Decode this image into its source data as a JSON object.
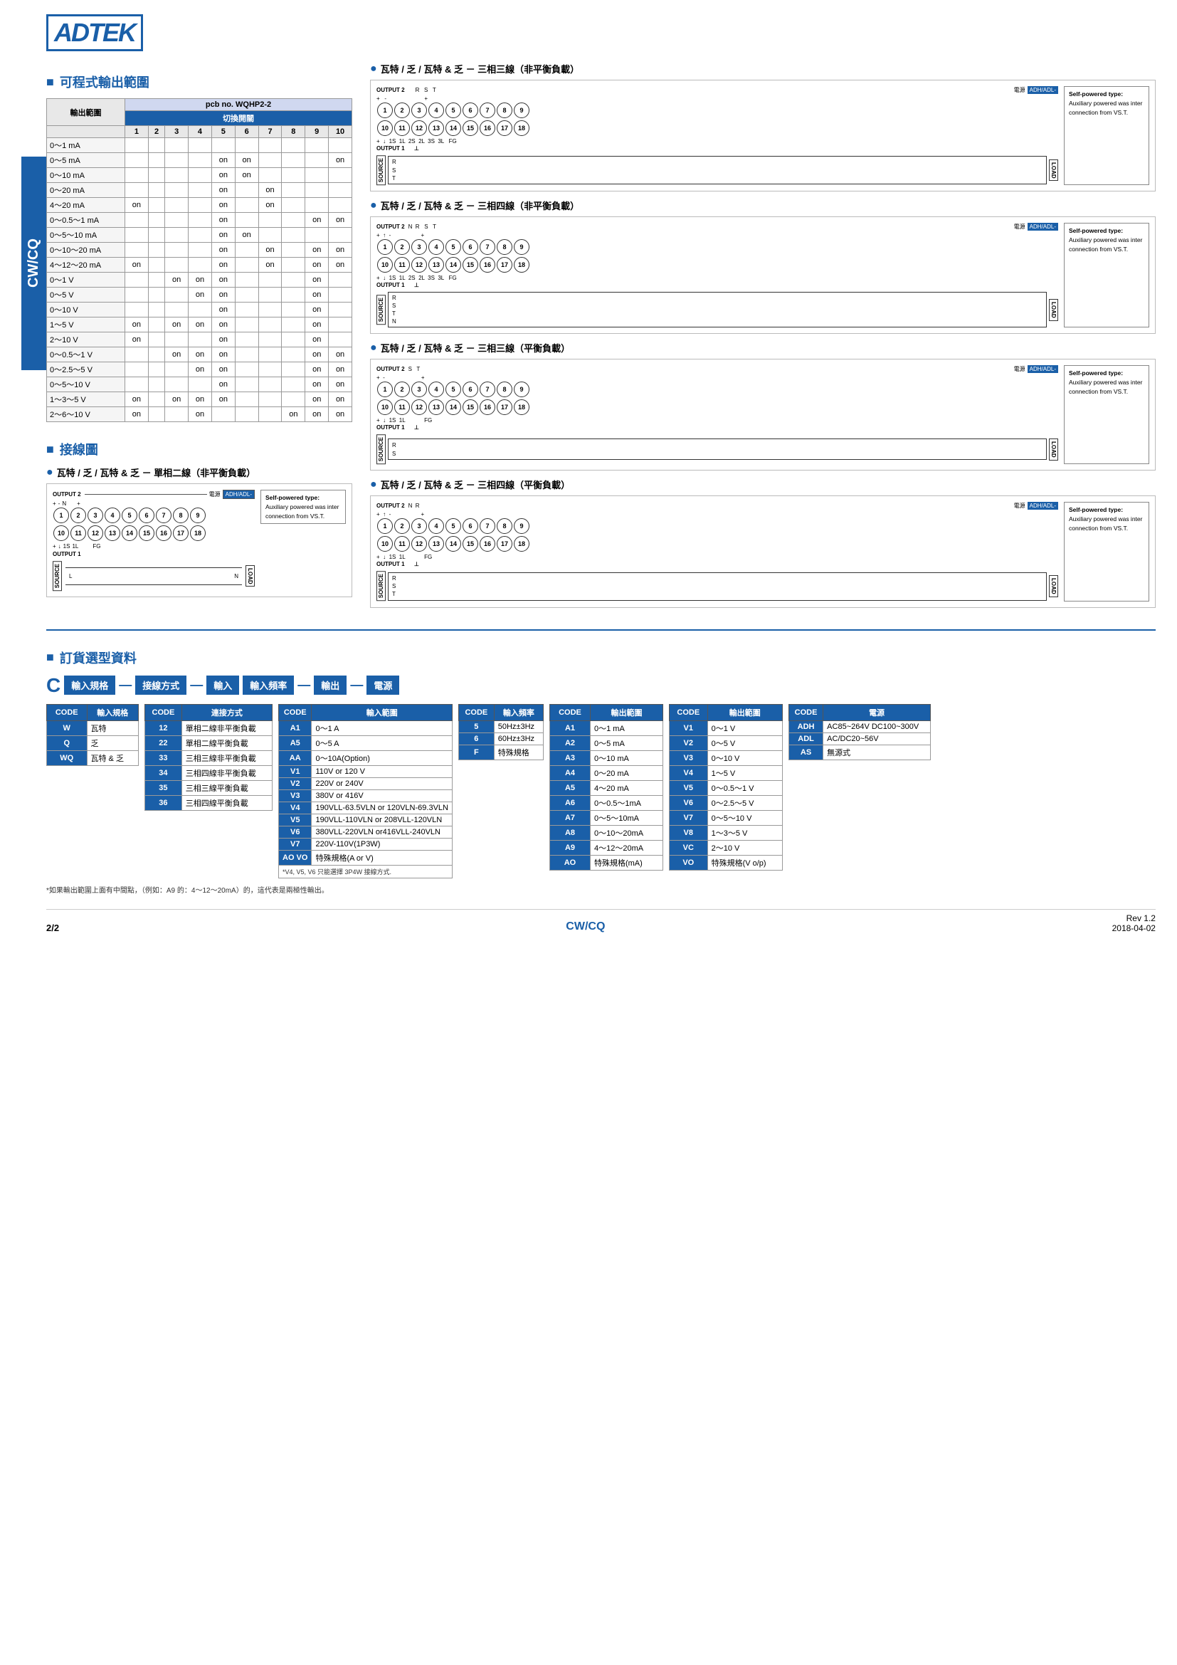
{
  "logo": "ADTEK",
  "page": {
    "number": "2/2",
    "model": "CW/CQ",
    "rev": "Rev 1.2",
    "date": "2018-04-02"
  },
  "sections": {
    "output_range": "可程式輸出範圍",
    "wiring": "接線圖",
    "order": "訂貨選型資料"
  },
  "output_range_table": {
    "pcb_header": "pcb no. WQHP2-2",
    "switch_header": "切換開關",
    "range_header": "輸出範圍",
    "columns": [
      "1",
      "2",
      "3",
      "4",
      "5",
      "6",
      "7",
      "8",
      "9",
      "10"
    ],
    "rows": [
      {
        "label": "0～1 mA",
        "cells": [
          "",
          "",
          "",
          "",
          "",
          "",
          "",
          "",
          "",
          ""
        ]
      },
      {
        "label": "0～5 mA",
        "cells": [
          "",
          "",
          "",
          "",
          "on",
          "on",
          "",
          "",
          "",
          "on"
        ]
      },
      {
        "label": "0～10 mA",
        "cells": [
          "",
          "",
          "",
          "",
          "on",
          "on",
          "",
          "",
          "",
          ""
        ]
      },
      {
        "label": "0～20 mA",
        "cells": [
          "",
          "",
          "",
          "",
          "on",
          "",
          "on",
          "",
          "",
          ""
        ]
      },
      {
        "label": "4～20 mA",
        "cells": [
          "on",
          "",
          "",
          "",
          "on",
          "",
          "on",
          "",
          "",
          ""
        ]
      },
      {
        "label": "0～0.5～1 mA",
        "cells": [
          "",
          "",
          "",
          "",
          "on",
          "",
          "",
          "",
          "on",
          "on"
        ]
      },
      {
        "label": "0～5～10 mA",
        "cells": [
          "",
          "",
          "",
          "",
          "on",
          "on",
          "",
          "",
          "",
          ""
        ]
      },
      {
        "label": "0～10～20 mA",
        "cells": [
          "",
          "",
          "",
          "",
          "on",
          "",
          "on",
          "",
          "on",
          "on"
        ]
      },
      {
        "label": "4～12～20 mA",
        "cells": [
          "on",
          "",
          "",
          "",
          "on",
          "",
          "on",
          "",
          "on",
          "on"
        ]
      },
      {
        "label": "0～1 V",
        "cells": [
          "",
          "",
          "on",
          "on",
          "on",
          "",
          "",
          "",
          "on",
          ""
        ]
      },
      {
        "label": "0～5 V",
        "cells": [
          "",
          "",
          "",
          "on",
          "on",
          "",
          "",
          "",
          "on",
          ""
        ]
      },
      {
        "label": "0～10 V",
        "cells": [
          "",
          "",
          "",
          "",
          "on",
          "",
          "",
          "",
          "on",
          ""
        ]
      },
      {
        "label": "1～5 V",
        "cells": [
          "on",
          "",
          "on",
          "on",
          "on",
          "",
          "",
          "",
          "on",
          ""
        ]
      },
      {
        "label": "2～10 V",
        "cells": [
          "on",
          "",
          "",
          "",
          "on",
          "",
          "",
          "",
          "on",
          ""
        ]
      },
      {
        "label": "0～0.5～1 V",
        "cells": [
          "",
          "",
          "on",
          "on",
          "on",
          "",
          "",
          "",
          "on",
          "on"
        ]
      },
      {
        "label": "0～2.5～5 V",
        "cells": [
          "",
          "",
          "",
          "on",
          "on",
          "",
          "",
          "",
          "on",
          "on"
        ]
      },
      {
        "label": "0～5～10 V",
        "cells": [
          "",
          "",
          "",
          "",
          "on",
          "",
          "",
          "",
          "on",
          "on"
        ]
      },
      {
        "label": "1～3～5 V",
        "cells": [
          "on",
          "",
          "on",
          "on",
          "on",
          "",
          "",
          "",
          "on",
          "on"
        ]
      },
      {
        "label": "2～6～10 V",
        "cells": [
          "on",
          "",
          "",
          "on",
          "",
          "",
          "",
          "on",
          "on",
          "on"
        ]
      }
    ]
  },
  "wiring_diagrams": {
    "single_phase_unbalanced": {
      "title": "瓦特 / 乏 / 瓦特 & 乏 － 單相二線（非平衡負載）",
      "terminals_top": [
        "1",
        "2",
        "3",
        "4",
        "5",
        "6",
        "7",
        "8",
        "9"
      ],
      "terminals_bottom": [
        "10",
        "11",
        "12",
        "13",
        "14",
        "15",
        "16",
        "17",
        "18"
      ],
      "labels_top": [
        "+",
        "-",
        "N"
      ],
      "labels_bottom": [
        "+",
        "↓",
        "1S",
        "1L",
        "FG"
      ],
      "output1_label": "OUTPUT 1",
      "output2_label": "OUTPUT 2",
      "power_label": "電源",
      "power_connector": "ADH/ADL-",
      "note_title": "Self-powered type:",
      "note_text": "Auxiliary powered was inter connection from VS.T."
    },
    "three_phase3_unbalanced": {
      "title": "瓦特 / 乏 / 瓦特 & 乏 － 三相三線（非平衡負載）",
      "note_title": "Self-powered type:",
      "note_text": "Auxiliary powered was inter connection from VS.T."
    },
    "three_phase4_unbalanced": {
      "title": "瓦特 / 乏 / 瓦特 & 乏 － 三相四線（非平衡負載）",
      "note_title": "Self-powered type:",
      "note_text": "Auxiliary powered was inter connection from VS.T."
    },
    "three_phase3_balanced": {
      "title": "瓦特 / 乏 / 瓦特 & 乏 － 三相三線（平衡負載）",
      "note_title": "Self-powered type:",
      "note_text": "Auxiliary powered was inter connection from VS.T."
    },
    "three_phase4_balanced": {
      "title": "瓦特 / 乏 / 瓦特 & 乏 － 三相四線（平衡負載）",
      "note_title": "Self-powered type:",
      "note_text": "Auxiliary powered was inter connection from VS.T."
    }
  },
  "order_table": {
    "title": "訂貨選型資料",
    "flow_c": "C",
    "flow_items": [
      "輸入規格",
      "—",
      "接線方式",
      "—",
      "輸入",
      "輸入頻率",
      "—",
      "輸出",
      "—",
      "電源"
    ],
    "code_input_spec": {
      "header_code": "CODE",
      "header_name": "輸入規格",
      "rows": [
        {
          "code": "W",
          "name": "瓦特"
        },
        {
          "code": "Q",
          "name": "乏"
        },
        {
          "code": "WQ",
          "name": "瓦特 & 乏"
        }
      ]
    },
    "code_connection": {
      "header_code": "CODE",
      "header_name": "連接方式",
      "rows": [
        {
          "code": "12",
          "name": "單相二線非平衡負載"
        },
        {
          "code": "22",
          "name": "單相二線平衡負載"
        },
        {
          "code": "33",
          "name": "三相三線非平衡負載"
        },
        {
          "code": "34",
          "name": "三相四線非平衡負載"
        },
        {
          "code": "35",
          "name": "三相三線平衡負載"
        },
        {
          "code": "36",
          "name": "三相四線平衡負載"
        }
      ]
    },
    "code_input_range": {
      "header_code": "CODE",
      "header_name": "輸入範圍",
      "rows": [
        {
          "code": "A1",
          "name": "0～1 A"
        },
        {
          "code": "A5",
          "name": "0～5 A"
        },
        {
          "code": "AA",
          "name": "0～10A(Option)"
        },
        {
          "code": "V1",
          "name": "110V or 120 V"
        },
        {
          "code": "V2",
          "name": "220V or 240V"
        },
        {
          "code": "V3",
          "name": "380V or 416V"
        },
        {
          "code": "V4",
          "name": "190VLL-63.5VLN or 120VLN-69.3VLN"
        },
        {
          "code": "V5",
          "name": "190VLL-110VLN or 208VLL-120VLN"
        },
        {
          "code": "V6",
          "name": "380VLL-220VLN or416VLL-240VLN"
        },
        {
          "code": "V7",
          "name": "220V-110V(1P3W)"
        },
        {
          "code": "AO VO",
          "name": "特殊規格(A or V)"
        },
        {
          "note": "*V4, V5, V6 只能選擇 3P4W 接線方式."
        }
      ]
    },
    "code_input_freq": {
      "header_code": "CODE",
      "header_name": "輸入頻率",
      "rows": [
        {
          "code": "5",
          "name": "50Hz±3Hz"
        },
        {
          "code": "6",
          "name": "60Hz±3Hz"
        },
        {
          "code": "F",
          "name": "特殊規格"
        }
      ]
    },
    "code_output_range1": {
      "header_code": "CODE",
      "header_name": "輸出範圍",
      "rows": [
        {
          "code": "A1",
          "name": "0～1 mA"
        },
        {
          "code": "A2",
          "name": "0～5 mA"
        },
        {
          "code": "A3",
          "name": "0～10 mA"
        },
        {
          "code": "A4",
          "name": "0～20 mA"
        },
        {
          "code": "A5",
          "name": "4～20 mA"
        },
        {
          "code": "A6",
          "name": "0～0.5～1mA"
        },
        {
          "code": "A7",
          "name": "0～5～10mA"
        },
        {
          "code": "A8",
          "name": "0～10～20mA"
        },
        {
          "code": "A9",
          "name": "4～12～20mA"
        },
        {
          "code": "AO",
          "name": "特殊規格(mA)"
        }
      ]
    },
    "code_output_range2": {
      "header_code": "CODE",
      "header_name": "輸出範圍",
      "rows": [
        {
          "code": "V1",
          "name": "0～1 V"
        },
        {
          "code": "V2",
          "name": "0～5 V"
        },
        {
          "code": "V3",
          "name": "0～10 V"
        },
        {
          "code": "V4",
          "name": "1～5 V"
        },
        {
          "code": "V5",
          "name": "0～0.5～1 V"
        },
        {
          "code": "V6",
          "name": "0～2.5～5 V"
        },
        {
          "code": "V7",
          "name": "0～5～10 V"
        },
        {
          "code": "V8",
          "name": "1～3～5 V"
        },
        {
          "code": "VC",
          "name": "2～10 V"
        },
        {
          "code": "VO",
          "name": "特殊規格(V o/p)"
        }
      ]
    },
    "code_power": {
      "header_code": "CODE",
      "header_name": "電源",
      "rows": [
        {
          "code": "ADH",
          "name": "AC85~264V DC100~300V"
        },
        {
          "code": "ADL",
          "name": "AC/DC20~56V"
        },
        {
          "code": "AS",
          "name": "無源式"
        }
      ]
    },
    "output_note": "*如果輸出範圍上面有中間點，（例如：A9 的：4～12～20mA）的，這代表是兩極性輸出。",
    "input_note": "5  50Hz±3Hz\n6  60Hz±3Hz\nF  特殊規格"
  },
  "colors": {
    "blue": "#1a5fa8",
    "light_blue_bg": "#d0d8f0",
    "table_border": "#999"
  }
}
